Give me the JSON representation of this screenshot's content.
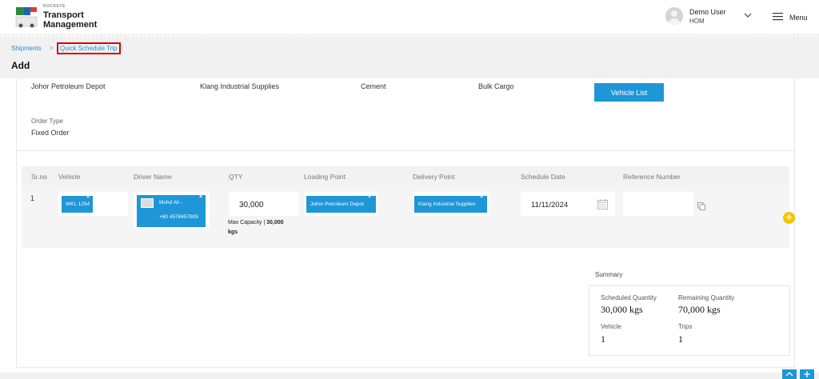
{
  "header": {
    "brand_small": "ROCKEYE",
    "brand_line1": "Transport",
    "brand_line2": "Management",
    "user_name": "Demo User",
    "user_role": "HOM",
    "menu_label": "Menu"
  },
  "breadcrumb": {
    "parent": "Shipments",
    "separator": "»",
    "current": "Quick Schedule Trip"
  },
  "page_title": "Add",
  "order": {
    "loading_point": "Johor Petroleum Depot",
    "delivery_point": "Klang Industrial Supplies",
    "material": "Cement",
    "cargo_type": "Bulk Cargo",
    "vehicle_list_button": "Vehicle List",
    "order_type_label": "Order Type",
    "order_type_value": "Fixed Order"
  },
  "table": {
    "headers": [
      "Sr.no",
      "Vehicle",
      "Driver Name",
      "QTY",
      "Loading Point",
      "Delivery Point",
      "Schedule Date",
      "Reference Number"
    ],
    "row": {
      "sr": "1",
      "vehicle": "WKL 1254",
      "driver_name": "Mohd Ali -",
      "driver_phone": "+60 4578457805",
      "qty": "30,000",
      "capacity_prefix": "Max Capacity | ",
      "capacity_value": "30,000",
      "capacity_unit": "kgs",
      "loading_point": "Johor Petroleum Depot",
      "delivery_point": "Klang Industrial Supplies",
      "schedule_date": "11/11/2024",
      "reference_number": ""
    },
    "chip_close": "×"
  },
  "summary": {
    "title": "Summary",
    "scheduled_label": "Scheduled Quantity",
    "scheduled_value": "30,000 kgs",
    "remaining_label": "Remaining Quantity",
    "remaining_value": "70,000 kgs",
    "vehicle_label": "Vehicle",
    "vehicle_value": "1",
    "trips_label": "Trips",
    "trips_value": "1"
  },
  "colors": {
    "accent": "#1e96d8",
    "add": "#f5c400",
    "highlight": "#e00000"
  }
}
